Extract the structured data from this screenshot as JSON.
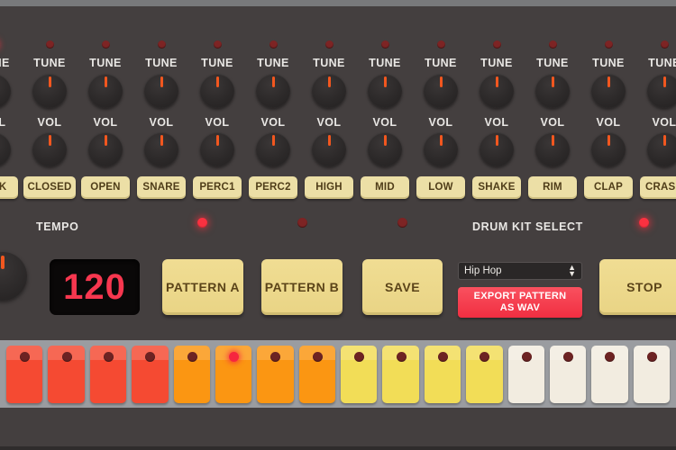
{
  "colors": {
    "panel": "#443f3f",
    "top_rail": "#78797b",
    "button_cream": "#ecdfa6",
    "button_yellow": "#ecd888",
    "led_on": "#fb3140",
    "led_off": "#7d2424",
    "knob_pointer": "#f2571f",
    "tempo_text": "#f7374f",
    "export_red": "#f12e41",
    "sequencer_rail": "#9a9ca0"
  },
  "channels": [
    {
      "name": "KICK",
      "tune_label": "TUNE",
      "vol_label": "VOL",
      "led_on": true
    },
    {
      "name": "CLOSED",
      "tune_label": "TUNE",
      "vol_label": "VOL",
      "led_on": false
    },
    {
      "name": "OPEN",
      "tune_label": "TUNE",
      "vol_label": "VOL",
      "led_on": false
    },
    {
      "name": "SNARE",
      "tune_label": "TUNE",
      "vol_label": "VOL",
      "led_on": false
    },
    {
      "name": "PERC1",
      "tune_label": "TUNE",
      "vol_label": "VOL",
      "led_on": false
    },
    {
      "name": "PERC2",
      "tune_label": "TUNE",
      "vol_label": "VOL",
      "led_on": false
    },
    {
      "name": "HIGH",
      "tune_label": "TUNE",
      "vol_label": "VOL",
      "led_on": false
    },
    {
      "name": "MID",
      "tune_label": "TUNE",
      "vol_label": "VOL",
      "led_on": false
    },
    {
      "name": "LOW",
      "tune_label": "TUNE",
      "vol_label": "VOL",
      "led_on": false
    },
    {
      "name": "SHAKE",
      "tune_label": "TUNE",
      "vol_label": "VOL",
      "led_on": false
    },
    {
      "name": "RIM",
      "tune_label": "TUNE",
      "vol_label": "VOL",
      "led_on": false
    },
    {
      "name": "CLAP",
      "tune_label": "TUNE",
      "vol_label": "VOL",
      "led_on": false
    },
    {
      "name": "CRASH",
      "tune_label": "TUNE",
      "vol_label": "VOL",
      "led_on": false
    }
  ],
  "controls": {
    "tempo_label": "TEMPO",
    "tempo_value": "120",
    "pattern_a_label": "PATTERN A",
    "pattern_b_label": "PATTERN B",
    "save_label": "SAVE",
    "stop_label": "STOP",
    "kit_select_label": "DRUM KIT SELECT",
    "kit_selected": "Hip Hop",
    "export_line1": "EXPORT PATTERN",
    "export_line2": "AS WAV",
    "led_pattern_a_on": true,
    "led_pattern_b_on": false,
    "led_save_on": false,
    "led_stop_on": true
  },
  "sequencer": {
    "active_step": 6,
    "steps": [
      {
        "index": 1,
        "group_color": "#f54a32",
        "led_on": false
      },
      {
        "index": 2,
        "group_color": "#f54a32",
        "led_on": false
      },
      {
        "index": 3,
        "group_color": "#f54a32",
        "led_on": false
      },
      {
        "index": 4,
        "group_color": "#f54a32",
        "led_on": false
      },
      {
        "index": 5,
        "group_color": "#fb9612",
        "led_on": false
      },
      {
        "index": 6,
        "group_color": "#fb9612",
        "led_on": true
      },
      {
        "index": 7,
        "group_color": "#fb9612",
        "led_on": false
      },
      {
        "index": 8,
        "group_color": "#fb9612",
        "led_on": false
      },
      {
        "index": 9,
        "group_color": "#f2dd57",
        "led_on": false
      },
      {
        "index": 10,
        "group_color": "#f2dd57",
        "led_on": false
      },
      {
        "index": 11,
        "group_color": "#f2dd57",
        "led_on": false
      },
      {
        "index": 12,
        "group_color": "#f2dd57",
        "led_on": false
      },
      {
        "index": 13,
        "group_color": "#f2ece0",
        "led_on": false
      },
      {
        "index": 14,
        "group_color": "#f2ece0",
        "led_on": false
      },
      {
        "index": 15,
        "group_color": "#f2ece0",
        "led_on": false
      },
      {
        "index": 16,
        "group_color": "#f2ece0",
        "led_on": false
      }
    ]
  }
}
